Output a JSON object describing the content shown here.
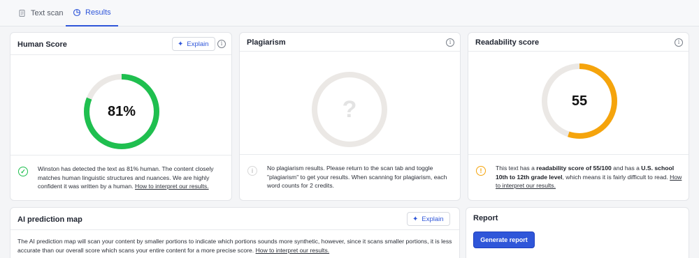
{
  "tabs": [
    {
      "label": "Text scan",
      "icon": "document-icon"
    },
    {
      "label": "Results",
      "icon": "chart-icon",
      "active": true
    }
  ],
  "human_score": {
    "title": "Human Score",
    "explain_label": "Explain",
    "value_text": "81%",
    "value": 81,
    "color": "#1fbf4f",
    "desc_prefix": "Winston has detected the text as 81% human. The content closely matches human linguistic structures and nuances. We are highly confident it was written by a human. ",
    "link": "How to interpret our results."
  },
  "plagiarism": {
    "title": "Plagiarism",
    "placeholder": "?",
    "message": "No plagiarism results. Please return to the scan tab and toggle \"plagiarism\" to get your results. When scanning for plagiarism, each word counts for 2 credits."
  },
  "readability": {
    "title": "Readability score",
    "value_text": "55",
    "value": 55,
    "max": 100,
    "color": "#f5a40c",
    "desc_1": "This text has a ",
    "desc_bold_1": "readability score of 55/100",
    "desc_2": " and has a ",
    "desc_bold_2": "U.S. school 10th to 12th grade level",
    "desc_3": ", which means it is fairly difficult to read. ",
    "link": "How to interpret our results."
  },
  "ai_map": {
    "title": "AI prediction map",
    "explain_label": "Explain",
    "desc": "The AI prediction map will scan your content by smaller portions to indicate which portions sounds more synthetic, however, since it scans smaller portions, it is less accurate than our overall score which scans your entire content for a more precise score. ",
    "link": "How to interpret our results."
  },
  "report": {
    "title": "Report",
    "button_label": "Generate report"
  },
  "colors": {
    "accent": "#2f56d9",
    "track": "#ebe8e5"
  }
}
